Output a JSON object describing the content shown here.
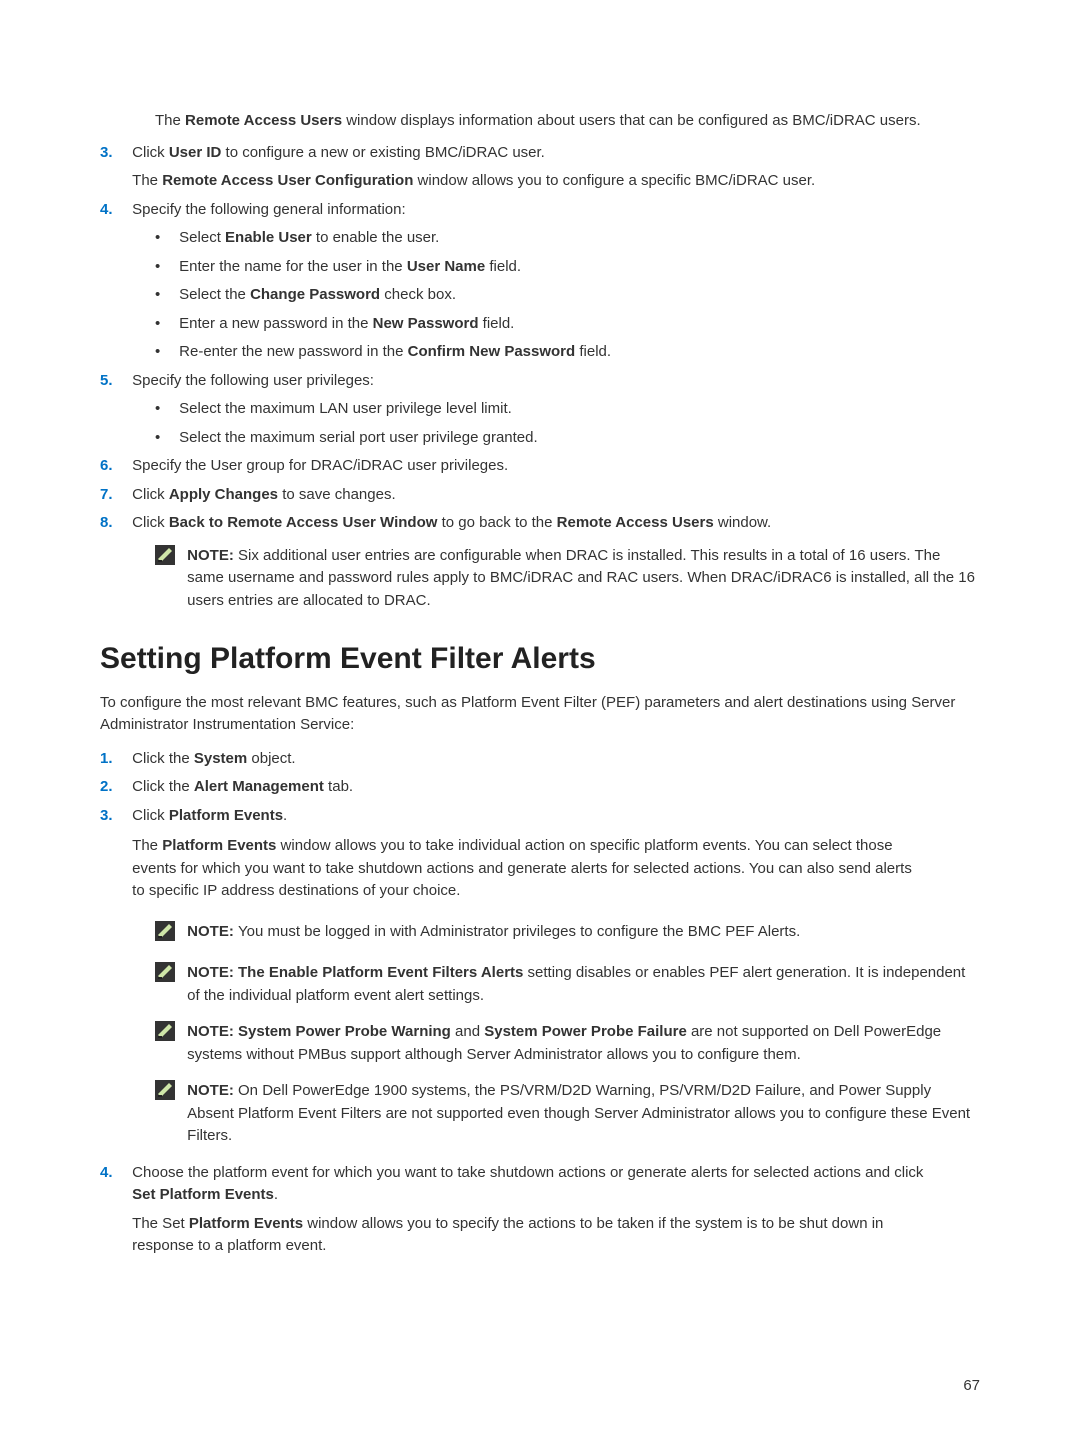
{
  "intro": {
    "p1_pre": "The ",
    "p1_bold": "Remote Access Users",
    "p1_post": " window displays information about users that can be configured as BMC/iDRAC users."
  },
  "step3": {
    "num": "3.",
    "pre": "Click ",
    "b1": "User ID",
    "post": " to configure a new or existing BMC/iDRAC user.",
    "line2_pre": "The ",
    "line2_b": "Remote Access User Configuration",
    "line2_post": " window allows you to configure a specific BMC/iDRAC user."
  },
  "step4": {
    "num": "4.",
    "text": "Specify the following general information:",
    "b1_pre": "Select ",
    "b1_b": "Enable User",
    "b1_post": " to enable the user.",
    "b2_pre": "Enter the name for the user in the ",
    "b2_b": "User Name",
    "b2_post": " field.",
    "b3_pre": "Select the ",
    "b3_b": "Change Password",
    "b3_post": " check box.",
    "b4_pre": "Enter a new password in the ",
    "b4_b": "New Password",
    "b4_post": " field.",
    "b5_pre": "Re-enter the new password in the ",
    "b5_b": "Confirm New Password",
    "b5_post": " field."
  },
  "step5": {
    "num": "5.",
    "text": "Specify the following user privileges:",
    "b1": "Select the maximum LAN user privilege level limit.",
    "b2": "Select the maximum serial port user privilege granted."
  },
  "step6": {
    "num": "6.",
    "text": "Specify the User group for DRAC/iDRAC user privileges."
  },
  "step7": {
    "num": "7.",
    "pre": "Click ",
    "b": "Apply Changes",
    "post": " to save changes."
  },
  "step8": {
    "num": "8.",
    "pre": "Click ",
    "b1": "Back to Remote Access User Window",
    "mid": " to go back to the ",
    "b2": "Remote Access Users",
    "post": " window."
  },
  "note_top": {
    "label": "NOTE: ",
    "text": "Six additional user entries are configurable when DRAC is installed. This results in a total of 16 users. The same username and password rules apply to BMC/iDRAC and RAC users. When DRAC/iDRAC6 is installed, all the 16 users entries are allocated to DRAC."
  },
  "heading": "Setting Platform Event Filter Alerts",
  "para_after_heading": "To configure the most relevant BMC features, such as Platform Event Filter (PEF) parameters and alert destinations using Server Administrator Instrumentation Service:",
  "p_step1": {
    "num": "1.",
    "pre": "Click the ",
    "b": "System",
    "post": " object."
  },
  "p_step2": {
    "num": "2.",
    "pre": "Click the ",
    "b": "Alert Management",
    "post": " tab."
  },
  "p_step3": {
    "num": "3.",
    "pre": "Click ",
    "b": "Platform Events",
    "post": ".",
    "para_pre": "The ",
    "para_b": "Platform Events",
    "para_post": " window allows you to take individual action on specific platform events. You can select those events for which you want to take shutdown actions and generate alerts for selected actions. You can also send alerts to specific IP address destinations of your choice."
  },
  "note1": {
    "label": "NOTE: ",
    "text": "You must be logged in with Administrator privileges to configure the BMC PEF Alerts."
  },
  "note2": {
    "label": "NOTE: ",
    "b": "The Enable Platform Event Filters Alerts",
    "text": " setting disables or enables PEF alert generation. It is independent of the individual platform event alert settings."
  },
  "note3": {
    "label": "NOTE: ",
    "b1": "System Power Probe Warning",
    "mid": " and ",
    "b2": "System Power Probe Failure",
    "text": " are not supported on Dell PowerEdge systems without PMBus support although Server Administrator allows you to configure them."
  },
  "note4": {
    "label": "NOTE: ",
    "text": "On Dell PowerEdge 1900 systems, the PS/VRM/D2D Warning, PS/VRM/D2D Failure, and Power Supply Absent Platform Event Filters are not supported even though Server Administrator allows you to configure these Event Filters."
  },
  "p_step4": {
    "num": "4.",
    "line1_pre": "Choose the platform event for which you want to take shutdown actions or generate alerts for selected actions and click ",
    "line1_b": "Set Platform Events",
    "line1_post": ".",
    "line2_pre": "The Set ",
    "line2_b": "Platform Events",
    "line2_post": " window allows you to specify the actions to be taken if the system is to be shut down in response to a platform event."
  },
  "page_number": "67"
}
